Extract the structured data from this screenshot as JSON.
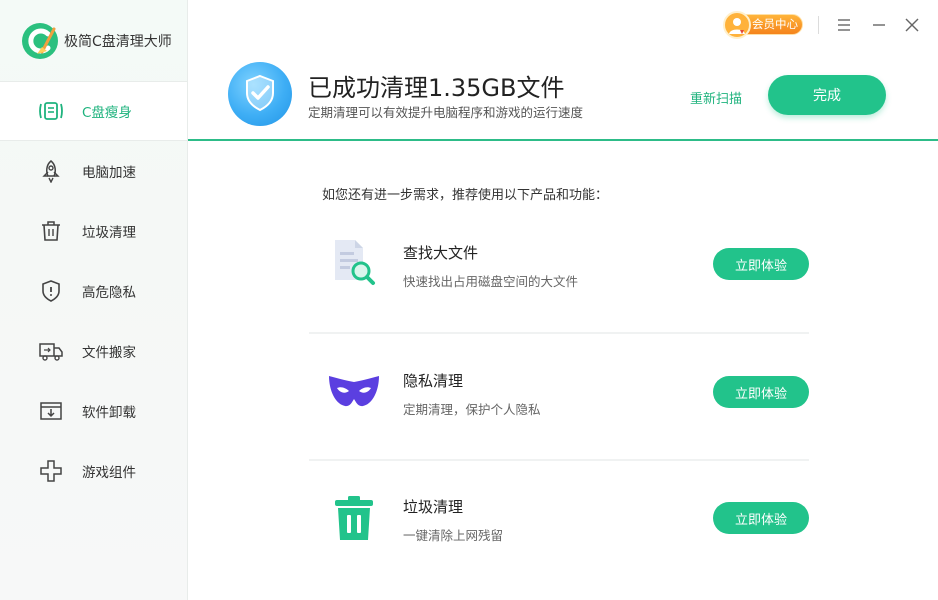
{
  "app": {
    "title": "极简C盘清理大师"
  },
  "sidebar": {
    "items": [
      {
        "label": "C盘瘦身",
        "icon": "c-drive-slim-icon",
        "active": true
      },
      {
        "label": "电脑加速",
        "icon": "rocket-icon",
        "active": false
      },
      {
        "label": "垃圾清理",
        "icon": "trash-icon",
        "active": false
      },
      {
        "label": "高危隐私",
        "icon": "shield-icon",
        "active": false
      },
      {
        "label": "文件搬家",
        "icon": "truck-icon",
        "active": false
      },
      {
        "label": "软件卸载",
        "icon": "uninstall-icon",
        "active": false
      },
      {
        "label": "游戏组件",
        "icon": "gamepad-icon",
        "active": false
      }
    ]
  },
  "topbar": {
    "vip_label": "会员中心"
  },
  "result": {
    "title": "已成功清理1.35GB文件",
    "subtitle": "定期清理可以有效提升电脑程序和游戏的运行速度",
    "rescan_label": "重新扫描",
    "done_label": "完成"
  },
  "recommend": {
    "heading": "如您还有进一步需求，推荐使用以下产品和功能：",
    "features": [
      {
        "name": "查找大文件",
        "desc": "快速找出占用磁盘空间的大文件",
        "button": "立即体验",
        "icon": "file-search-icon"
      },
      {
        "name": "隐私清理",
        "desc": "定期清理，保护个人隐私",
        "button": "立即体验",
        "icon": "mask-icon"
      },
      {
        "name": "垃圾清理",
        "desc": "一键清除上网残留",
        "button": "立即体验",
        "icon": "trash-can-icon"
      }
    ]
  },
  "colors": {
    "accent": "#22c38b",
    "accent_text": "#1fb37e",
    "vip": "#f5831c",
    "shield": "#3eaef5",
    "mask": "#5b3fe0"
  }
}
